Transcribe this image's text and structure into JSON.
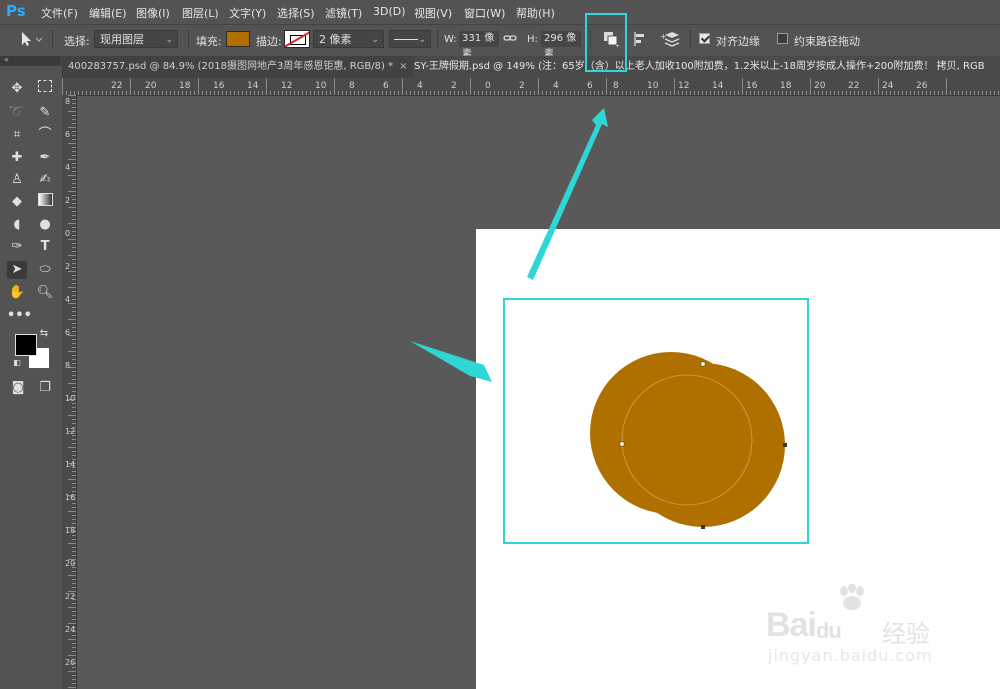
{
  "app": {
    "logo": "Ps"
  },
  "menu": [
    "文件(F)",
    "编辑(E)",
    "图像(I)",
    "图层(L)",
    "文字(Y)",
    "选择(S)",
    "滤镜(T)",
    "3D(D)",
    "视图(V)",
    "窗口(W)",
    "帮助(H)"
  ],
  "options": {
    "select_label": "选择:",
    "select_value": "现用图层",
    "fill_label": "填充:",
    "fill_color": "#b07000",
    "stroke_label": "描边:",
    "stroke_width": "2 像素",
    "w_label": "W:",
    "w_value": "331 像素",
    "h_label": "H:",
    "h_value": "296 像素",
    "align_edges_label": "对齐边缘",
    "align_edges_checked": true,
    "constrain_path_label": "约束路径拖动",
    "constrain_path_checked": false
  },
  "tabs": [
    {
      "label": "400283757.psd @ 84.9% (2018摄图网地产3周年感恩钜惠, RGB/8) *",
      "close": "×"
    },
    {
      "label": "SY-王牌假期.psd @ 149% (注：65岁（含）以上老人加收100附加费，1.2米以上-18周岁按成人操作+200附加费！ 拷贝, RGB"
    }
  ],
  "ruler_top": [
    "22",
    "20",
    "18",
    "16",
    "14",
    "12",
    "10",
    "8",
    "6",
    "4",
    "2",
    "0",
    "2",
    "4",
    "6",
    "8",
    "10",
    "12",
    "14",
    "16",
    "18",
    "20",
    "22",
    "24",
    "26"
  ],
  "ruler_left": [
    "8",
    "6",
    "4",
    "2",
    "0",
    "2",
    "4",
    "6",
    "8",
    "10",
    "12",
    "14",
    "16",
    "18",
    "20",
    "22",
    "24",
    "26"
  ],
  "shape": {
    "color": "#b07000",
    "outline_color": "#d8a24a"
  },
  "highlight_color": "#2ed6d6",
  "watermark": {
    "main": "Bai",
    "du": "du",
    "cn": "经验",
    "url": "jingyan.baidu.com"
  }
}
